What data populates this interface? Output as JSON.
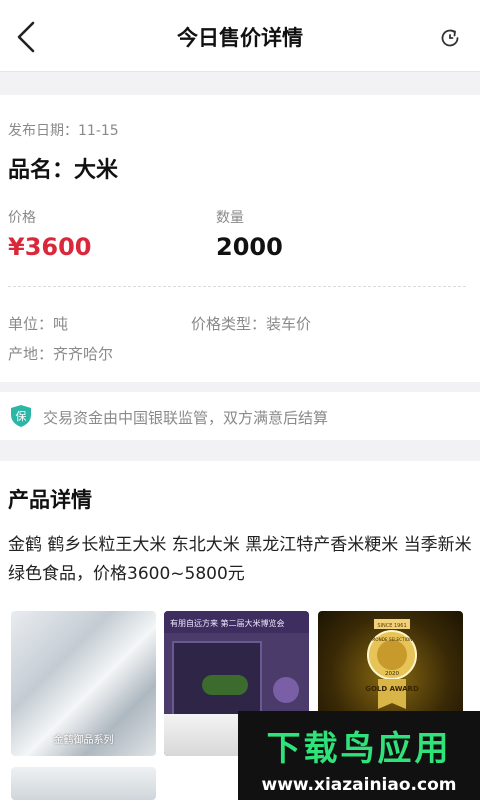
{
  "header": {
    "title": "今日售价详情",
    "back_icon": "chevron-left-icon",
    "refresh_icon": "refresh-icon"
  },
  "card": {
    "publish_date": "发布日期：11-15",
    "product_name": "品名：大米",
    "price_label": "价格",
    "price_value": "¥3600",
    "quantity_label": "数量",
    "quantity_value": "2000",
    "unit": "单位：吨",
    "price_type": "价格类型：装车价",
    "origin": "产地：齐齐哈尔"
  },
  "notice": {
    "icon_text": "保",
    "text": "交易资金由中国银联监管，双方满意后结算"
  },
  "detail": {
    "title": "产品详情",
    "description": "金鹤 鹤乡长粒王大米 东北大米 黑龙江特产香米粳米 当季新米绿色食品，价格3600~5800元",
    "images": [
      {
        "caption": "金鹤御品系列"
      },
      {
        "banner": "有朋自远方来 第二届大米博览会"
      },
      {
        "medal_top": "SINCE 1961",
        "medal_mid": "MONDE SELECTION",
        "medal_year": "2020",
        "medal_bottom": "GOLD AWARD"
      }
    ]
  },
  "watermark": {
    "big": "下载鸟应用",
    "small": "www.xiazainiao.com"
  },
  "colors": {
    "price_red": "#d9283a",
    "shield_teal": "#2bb6a6",
    "watermark_green": "#2fe27a"
  }
}
